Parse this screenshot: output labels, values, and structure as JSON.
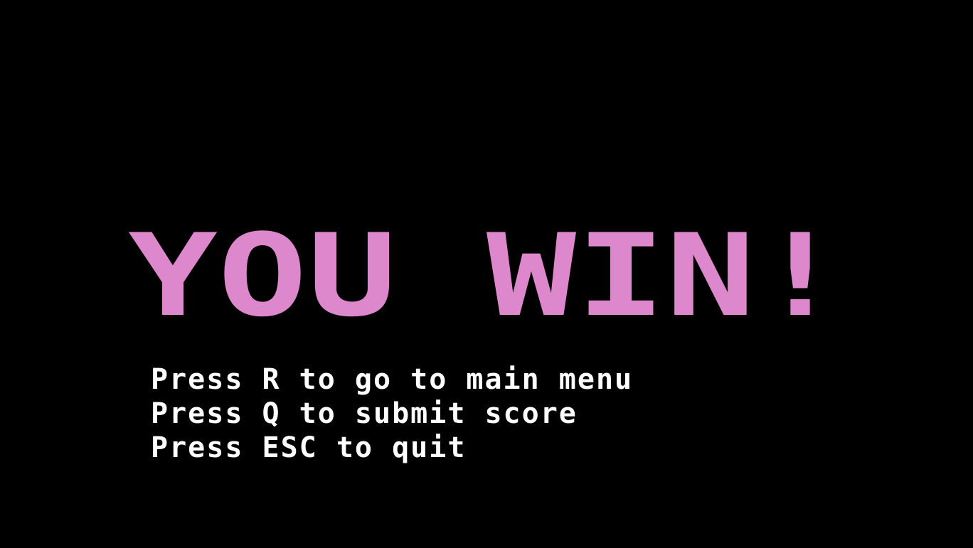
{
  "game": {
    "title": "YOU WIN!",
    "instructions": [
      "Press R to go to main menu",
      "Press Q to submit score",
      "Press ESC to quit"
    ]
  },
  "colors": {
    "background": "#000000",
    "title": "#DD88CC",
    "text": "#FFFFFF"
  }
}
